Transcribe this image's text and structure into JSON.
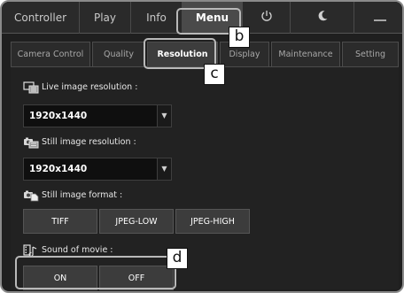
{
  "top_tabs": [
    "Controller",
    "Play",
    "Info",
    "Menu"
  ],
  "top_icons": [
    "power-icon",
    "moon-icon",
    "minimize-icon"
  ],
  "sub_tabs": [
    "Camera Control",
    "Quality",
    "Resolution",
    "Display",
    "Maintenance",
    "Setting"
  ],
  "live": {
    "label": "Live image resolution :",
    "value": "1920x1440",
    "icon": "live-image-icon"
  },
  "still": {
    "label": "Still image resolution :",
    "value": "1920x1440",
    "icon": "still-image-icon"
  },
  "format": {
    "label": "Still image format :",
    "options": [
      "TIFF",
      "JPEG-LOW",
      "JPEG-HIGH"
    ],
    "icon": "image-format-icon"
  },
  "sound": {
    "label": "Sound of movie :",
    "options": [
      "ON",
      "OFF"
    ],
    "icon": "sound-movie-icon"
  },
  "callouts": [
    "b",
    "c",
    "d"
  ]
}
